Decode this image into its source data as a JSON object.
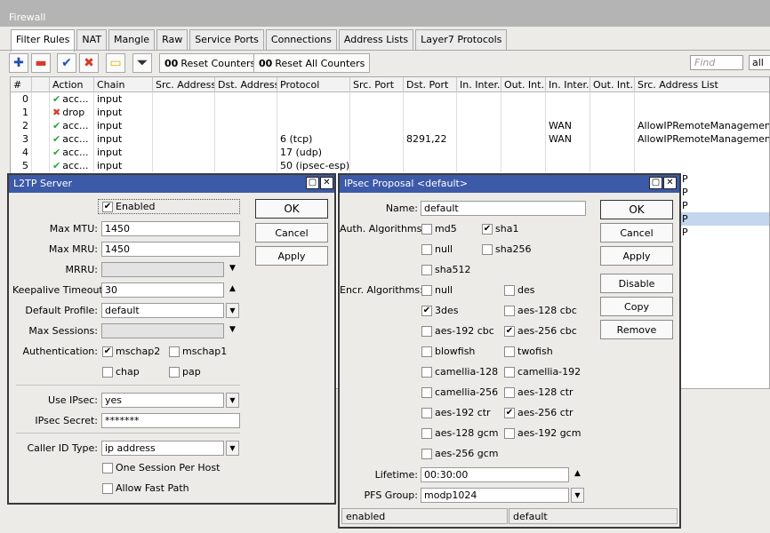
{
  "window": {
    "title": "Firewall"
  },
  "tabs": [
    "Filter Rules",
    "NAT",
    "Mangle",
    "Raw",
    "Service Ports",
    "Connections",
    "Address Lists",
    "Layer7 Protocols"
  ],
  "toolbar": {
    "reset_counters": "Reset Counters",
    "reset_all_counters": "Reset All Counters",
    "counter_glyph": "00",
    "find_placeholder": "Find",
    "filter_value": "all",
    "icons": [
      "add-icon",
      "remove-icon",
      "enable-icon",
      "disable-icon",
      "comment-icon",
      "filter-icon"
    ]
  },
  "table": {
    "columns": [
      "#",
      "",
      "Action",
      "Chain",
      "Src. Address",
      "Dst. Address",
      "Protocol",
      "Src. Port",
      "Dst. Port",
      "In. Inter...",
      "Out. Int...",
      "In. Inter...",
      "Out. Int...",
      "Src. Address List"
    ],
    "rows": [
      {
        "num": "0",
        "action": "acc...",
        "chain": "input",
        "protocol": "",
        "dst_port": "",
        "in_list": "",
        "src_list": ""
      },
      {
        "num": "1",
        "action": "drop",
        "chain": "input",
        "protocol": "",
        "dst_port": "",
        "in_list": "",
        "src_list": ""
      },
      {
        "num": "2",
        "action": "acc...",
        "chain": "input",
        "protocol": "",
        "dst_port": "",
        "in_list": "WAN",
        "src_list": "AllowIPRemoteManagement"
      },
      {
        "num": "3",
        "action": "acc...",
        "chain": "input",
        "protocol": "6 (tcp)",
        "dst_port": "8291,22",
        "in_list": "WAN",
        "src_list": "AllowIPRemoteManagement"
      },
      {
        "num": "4",
        "action": "acc...",
        "chain": "input",
        "protocol": "17 (udp)",
        "dst_port": "",
        "in_list": "",
        "src_list": ""
      },
      {
        "num": "5",
        "action": "acc...",
        "chain": "input",
        "protocol": "50 (ipsec-esp)",
        "dst_port": "",
        "in_list": "",
        "src_list": ""
      }
    ],
    "hidden_rows_fragment": [
      "P",
      "P",
      "P",
      "P",
      "P"
    ]
  },
  "l2tp": {
    "title": "L2TP Server",
    "enabled_label": "Enabled",
    "labels": {
      "max_mtu": "Max MTU:",
      "max_mru": "Max MRU:",
      "mrru": "MRRU:",
      "keepalive": "Keepalive Timeout:",
      "profile": "Default Profile:",
      "max_sessions": "Max Sessions:",
      "auth": "Authentication:",
      "use_ipsec": "Use IPsec:",
      "ipsec_secret": "IPsec Secret:",
      "caller_id": "Caller ID Type:"
    },
    "values": {
      "max_mtu": "1450",
      "max_mru": "1450",
      "mrru": "",
      "keepalive": "30",
      "profile": "default",
      "max_sessions": "",
      "use_ipsec": "yes",
      "ipsec_secret": "*******",
      "caller_id": "ip address"
    },
    "auth_opts": [
      "mschap2",
      "mschap1",
      "chap",
      "pap"
    ],
    "one_session": "One Session Per Host",
    "allow_fast_path": "Allow Fast Path",
    "buttons": [
      "OK",
      "Cancel",
      "Apply"
    ]
  },
  "ipsec": {
    "title": "IPsec Proposal <default>",
    "labels": {
      "name": "Name:",
      "auth": "Auth. Algorithms:",
      "encr": "Encr. Algorithms:",
      "lifetime": "Lifetime:",
      "pfs": "PFS Group:"
    },
    "values": {
      "name": "default",
      "lifetime": "00:30:00",
      "pfs": "modp1024"
    },
    "auth_algs": [
      "md5",
      "sha1",
      "null",
      "sha256",
      "sha512"
    ],
    "encr_algs": [
      "null",
      "des",
      "3des",
      "aes-128 cbc",
      "aes-192 cbc",
      "aes-256 cbc",
      "blowfish",
      "twofish",
      "camellia-128",
      "camellia-192",
      "camellia-256",
      "aes-128 ctr",
      "aes-192 ctr",
      "aes-256 ctr",
      "aes-128 gcm",
      "aes-192 gcm",
      "aes-256 gcm"
    ],
    "buttons": [
      "OK",
      "Cancel",
      "Apply",
      "Disable",
      "Copy",
      "Remove"
    ],
    "status": {
      "left": "enabled",
      "right": "default"
    }
  },
  "colors": {
    "dialog_title": "#3c5aa8",
    "selected_row": "#c3d6ee",
    "accept_check": "#2aa53a",
    "drop_x": "#d63a2a"
  }
}
